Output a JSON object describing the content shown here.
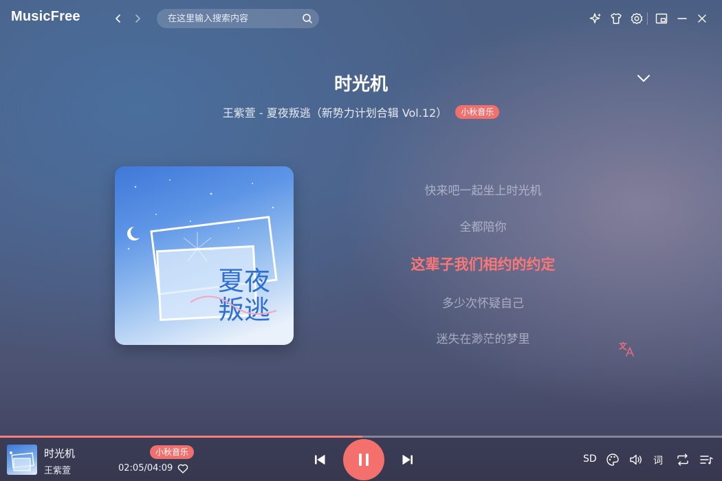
{
  "app": {
    "name": "MusicFree"
  },
  "search": {
    "placeholder": "在这里输入搜索内容"
  },
  "song": {
    "title": "时光机",
    "meta": "王紫萱 - 夏夜叛逃（新势力计划合辑 Vol.12）",
    "artist": "王紫萱",
    "source_tag": "小秋音乐"
  },
  "album_art": {
    "title_line1": "夏夜",
    "title_line2": "叛逃"
  },
  "lyrics": [
    {
      "text": "快来吧一起坐上时光机",
      "active": false
    },
    {
      "text": "全都陪你",
      "active": false
    },
    {
      "text": "这辈子我们相约的约定",
      "active": true
    },
    {
      "text": "多少次怀疑自己",
      "active": false
    },
    {
      "text": "迷失在渺茫的梦里",
      "active": false
    }
  ],
  "player": {
    "current_time": "02:05",
    "total_time": "04:09",
    "time_display": "02:05/04:09",
    "progress": 0.502,
    "quality_label": "SD",
    "lyric_label": "词"
  },
  "colors": {
    "accent": "#f4706c",
    "lyric_active": "#fb7777",
    "tag_bg": "#f0706e"
  },
  "icons": {
    "back": "chevron-left-icon",
    "forward": "chevron-right-icon",
    "search": "search-icon",
    "sparkle": "sparkle-icon",
    "theme": "shirt-icon",
    "settings": "gear-icon",
    "minimode": "picture-in-picture-icon",
    "minimize": "minimize-icon",
    "close": "close-icon",
    "collapse": "chevron-down-icon",
    "translate": "translate-icon",
    "favorite": "heart-icon",
    "prev": "skip-previous-icon",
    "pause": "pause-icon",
    "next": "skip-next-icon",
    "sound_effect": "palette-icon",
    "volume": "volume-icon",
    "repeat": "repeat-icon",
    "playlist": "playlist-icon"
  }
}
